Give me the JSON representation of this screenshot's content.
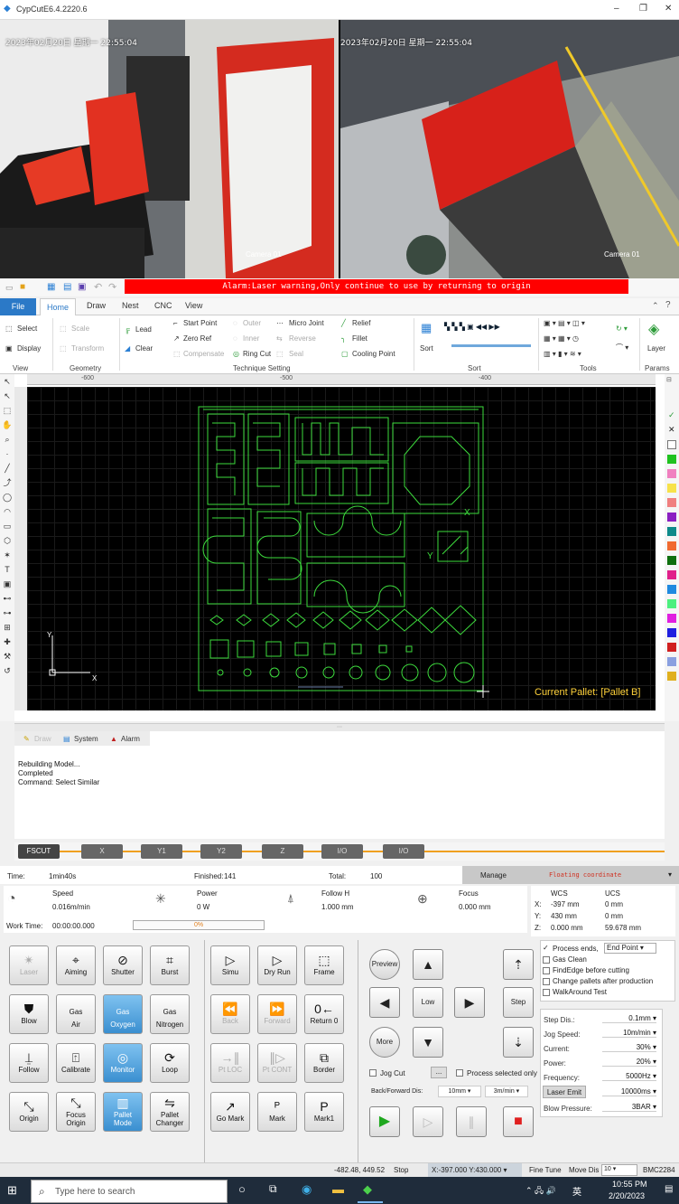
{
  "window": {
    "title": "CypCutE6.4.2220.6",
    "minimize": "–",
    "restore": "❐",
    "close": "✕"
  },
  "cameras": [
    {
      "timestamp": "2023年02月20日 星期一 22:55:04",
      "label": "Camera 01"
    },
    {
      "timestamp": "2023年02月20日 星期一 22:55:04",
      "label": "Camera 01"
    }
  ],
  "alarm": "Alarm:Laser warning,Only continue to use by returning to origin",
  "menu_tabs": [
    "File",
    "Home",
    "Draw",
    "Nest",
    "CNC",
    "View"
  ],
  "ribbon": {
    "view": {
      "select": "Select",
      "display": "Display",
      "group": "View"
    },
    "geometry": {
      "scale": "Scale",
      "transform": "Transform",
      "group": "Geometry"
    },
    "technique": {
      "lead": "Lead",
      "clear": "Clear",
      "start_point": "Start Point",
      "zero_ref": "Zero Ref",
      "compensate": "Compensate",
      "outer": "Outer",
      "inner": "Inner",
      "ring_cut": "Ring Cut",
      "micro_joint": "Micro Joint",
      "reverse": "Reverse",
      "seal": "Seal",
      "relief": "Relief",
      "fillet": "Fillet",
      "cooling_point": "Cooling Point",
      "group": "Technique Setting"
    },
    "sort": {
      "sort": "Sort",
      "group": "Sort"
    },
    "tools": {
      "group": "Tools"
    },
    "params": {
      "layer": "Layer",
      "group": "Params"
    }
  },
  "ruler": {
    "ticks": [
      "-600",
      "-500",
      "-400"
    ]
  },
  "canvas": {
    "pallet": "Current Pallet: [Pallet B]",
    "axis_x": "X",
    "axis_y": "Y",
    "mark_x": "X",
    "mark_y": "Y"
  },
  "console": {
    "tabs": [
      "Draw",
      "System",
      "Alarm"
    ],
    "log": [
      "Rebuilding Model...",
      "Completed",
      "Command: Select Similar"
    ]
  },
  "axis_bar": [
    "FSCUT",
    "X",
    "Y1",
    "Y2",
    "Z",
    "I/O",
    "I/O"
  ],
  "status_header": {
    "time_label": "Time:",
    "time_value": "1min40s",
    "finished_label": "Finished:",
    "finished_value": "141",
    "total_label": "Total:",
    "total_value": "100",
    "manage": "Manage",
    "floating": "Floating coordinate"
  },
  "metrics": {
    "speed_label": "Speed",
    "speed_value": "0.016m/min",
    "power_label": "Power",
    "power_value": "0 W",
    "follow_label": "Follow H",
    "follow_value": "1.000 mm",
    "focus_label": "Focus",
    "focus_value": "0.000 mm",
    "worktime_label": "Work Time:",
    "worktime_value": "00:00:00.000",
    "progress": "0%"
  },
  "coords": {
    "wcs": "WCS",
    "ucs": "UCS",
    "x_label": "X:",
    "x_wcs": "-397 mm",
    "x_ucs": "0 mm",
    "y_label": "Y:",
    "y_wcs": "430 mm",
    "y_ucs": "0 mm",
    "z_label": "Z:",
    "z_wcs": "0.000 mm",
    "z_ucs": "59.678 mm"
  },
  "buttons_left": [
    [
      "Laser",
      "Aiming",
      "Shutter",
      "Burst"
    ],
    [
      "Blow",
      "Air",
      "Oxygen",
      "Nitrogen"
    ],
    [
      "Follow",
      "Calibrate",
      "Monitor",
      "Loop"
    ],
    [
      "Origin",
      "Focus Origin",
      "Pallet Mode",
      "Pallet Changer"
    ]
  ],
  "gas_prefix": "Gas",
  "buttons_mid": [
    [
      "Simu",
      "Dry Run",
      "Frame"
    ],
    [
      "Back",
      "Forward",
      "Return 0"
    ],
    [
      "Pt LOC",
      "Pt CONT",
      "Border"
    ],
    [
      "Go Mark",
      "Mark",
      "Mark1"
    ]
  ],
  "jog": {
    "preview": "Preview",
    "more": "More",
    "low": "Low",
    "step": "Step",
    "jog_cut": "Jog Cut",
    "ellipsis": "...",
    "process_selected": "Process selected only",
    "bf_label": "Back/Forward Dis:",
    "bf_dist": "10mm",
    "bf_speed": "3m/min"
  },
  "options": {
    "process_ends": "Process ends,",
    "end_point": "End Point",
    "gas_clean": "Gas Clean",
    "find_edge": "FindEdge before cutting",
    "change_pallets": "Change pallets after production",
    "walkaround": "WalkAround Test"
  },
  "params_panel": [
    {
      "label": "Step Dis.:",
      "value": "0.1mm"
    },
    {
      "label": "Jog Speed:",
      "value": "10m/min"
    },
    {
      "label": "Current:",
      "value": "30%"
    },
    {
      "label": "Power:",
      "value": "20%"
    },
    {
      "label": "Frequency:",
      "value": "5000Hz"
    },
    {
      "label": "Laser Emit",
      "value": "10000ms"
    },
    {
      "label": "Blow Pressure:",
      "value": "3BAR"
    }
  ],
  "statusbar": {
    "coord": "-482.48, 449.52",
    "state": "Stop",
    "pos": "X:-397.000 Y:430.000",
    "finetune": "Fine Tune",
    "movedis": "Move Dis",
    "movedis_val": "10",
    "device": "BMC2284"
  },
  "taskbar": {
    "search": "Type here to search",
    "ime": "英",
    "time": "10:55 PM",
    "date": "2/20/2023"
  }
}
